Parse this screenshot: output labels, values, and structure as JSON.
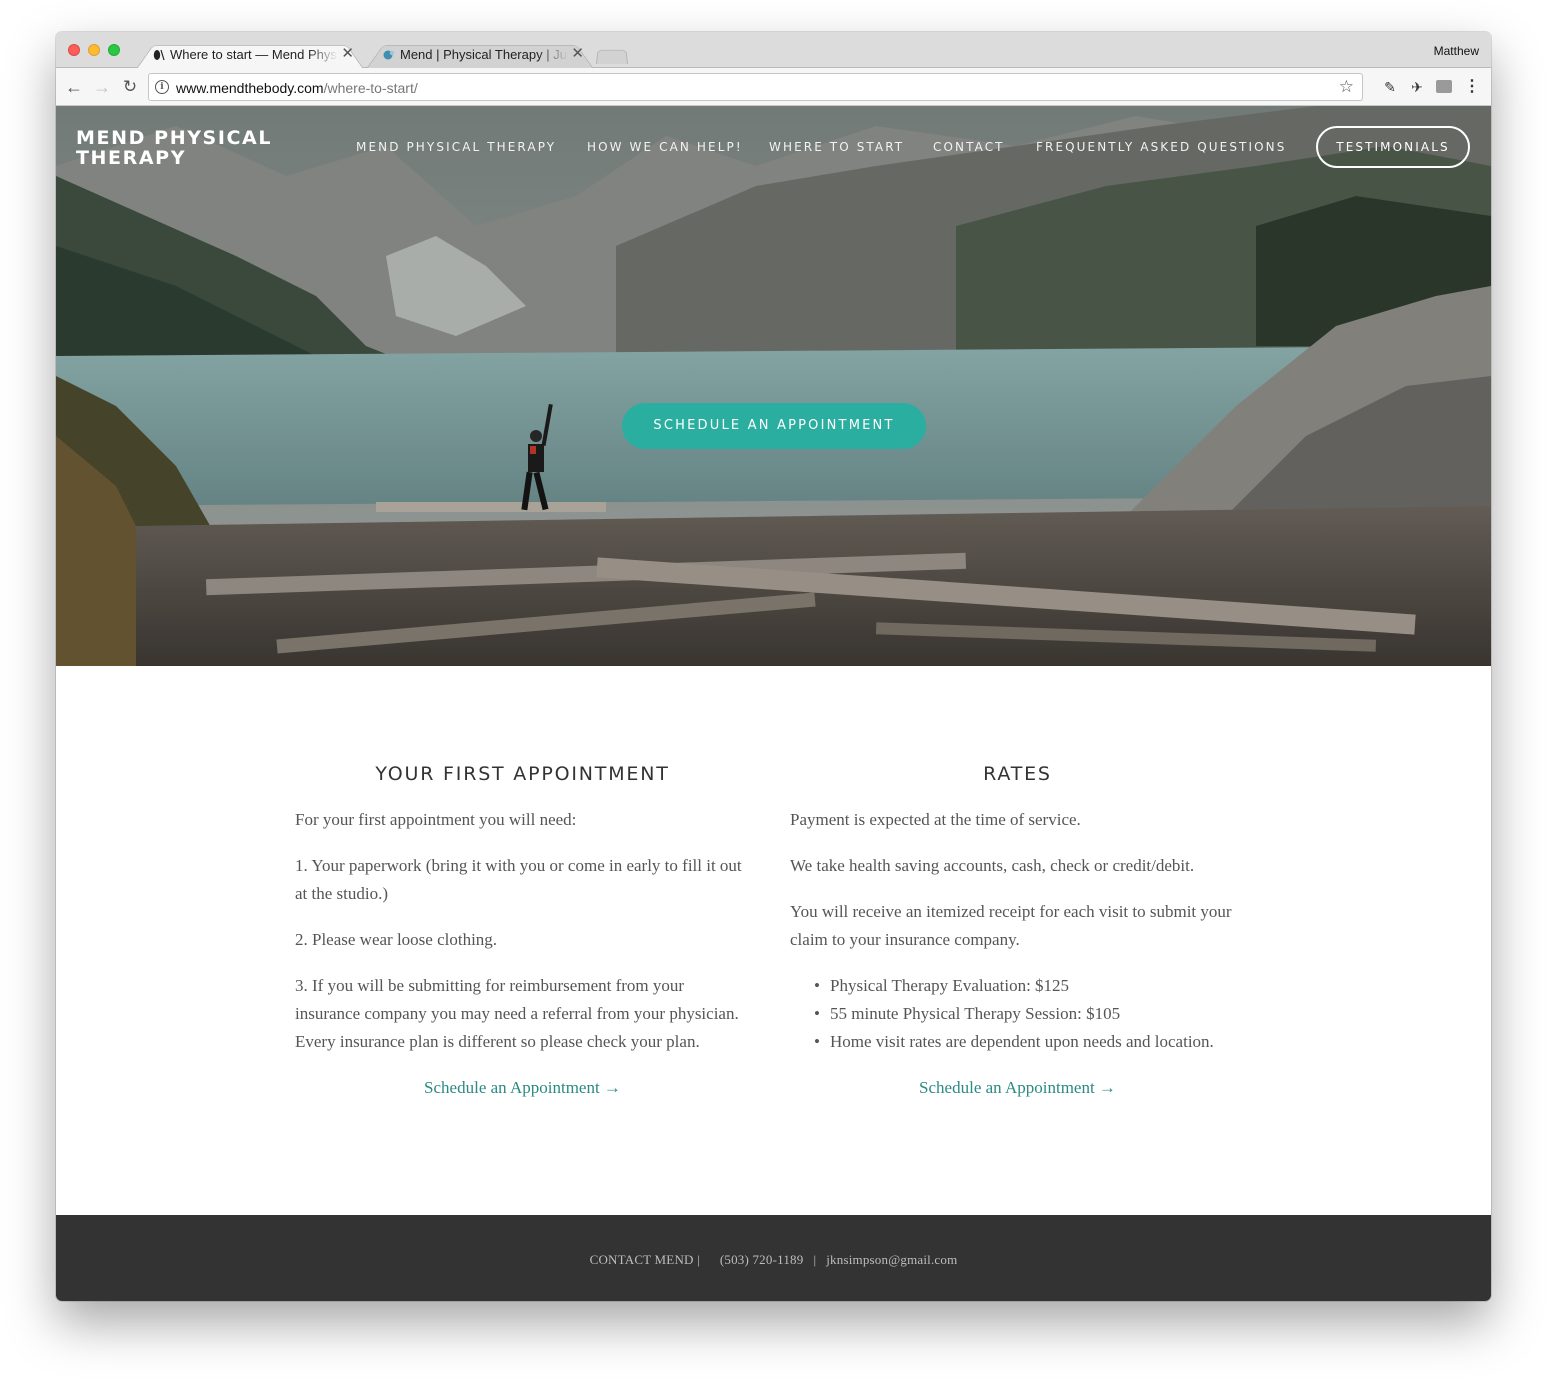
{
  "browser": {
    "tabs": [
      {
        "title": "Where to start — Mend Physical Therapy"
      },
      {
        "title": "Mend | Physical Therapy | Julie Simpson"
      }
    ],
    "profile_name": "Matthew",
    "url_host": "www.mendthebody.com",
    "url_path": "/where-to-start/"
  },
  "site": {
    "logo": "MEND PHYSICAL THERAPY",
    "nav": [
      "MEND PHYSICAL THERAPY",
      "HOW WE CAN HELP!",
      "WHERE TO START",
      "CONTACT",
      "FREQUENTLY ASKED QUESTIONS"
    ],
    "nav_cta": "TESTIMONIALS",
    "hero_cta": "SCHEDULE AN APPOINTMENT"
  },
  "first_appointment": {
    "heading": "YOUR FIRST APPOINTMENT",
    "intro": "For your first appointment you will need:",
    "items": [
      "1.  Your paperwork (bring it with you or come in early to fill it out at the studio.)",
      "2.  Please wear loose clothing.",
      "3.  If you will be submitting for reimbursement from your insurance company you may need a referral from your physician. Every insurance plan is different so please check your plan."
    ],
    "link": "Schedule an Appointment →"
  },
  "rates": {
    "heading": "RATES",
    "paragraphs": [
      "Payment is expected at the time of service.",
      "We take health saving accounts, cash, check or credit/debit.",
      "You will receive an itemized receipt for each visit to submit your claim to your insurance company."
    ],
    "list": [
      "Physical Therapy Evaluation:  $125",
      "55 minute Physical Therapy Session:  $105",
      "Home visit rates are dependent upon needs and location."
    ],
    "link": "Schedule an Appointment →"
  },
  "footer": {
    "contact": "CONTACT MEND |",
    "phone": "(503) 720-1189",
    "divider": "|",
    "email": "jknsimpson@gmail.com"
  },
  "colors": {
    "accent": "#2aaea0",
    "link": "#2a8a82",
    "footer_bg": "#333333"
  }
}
